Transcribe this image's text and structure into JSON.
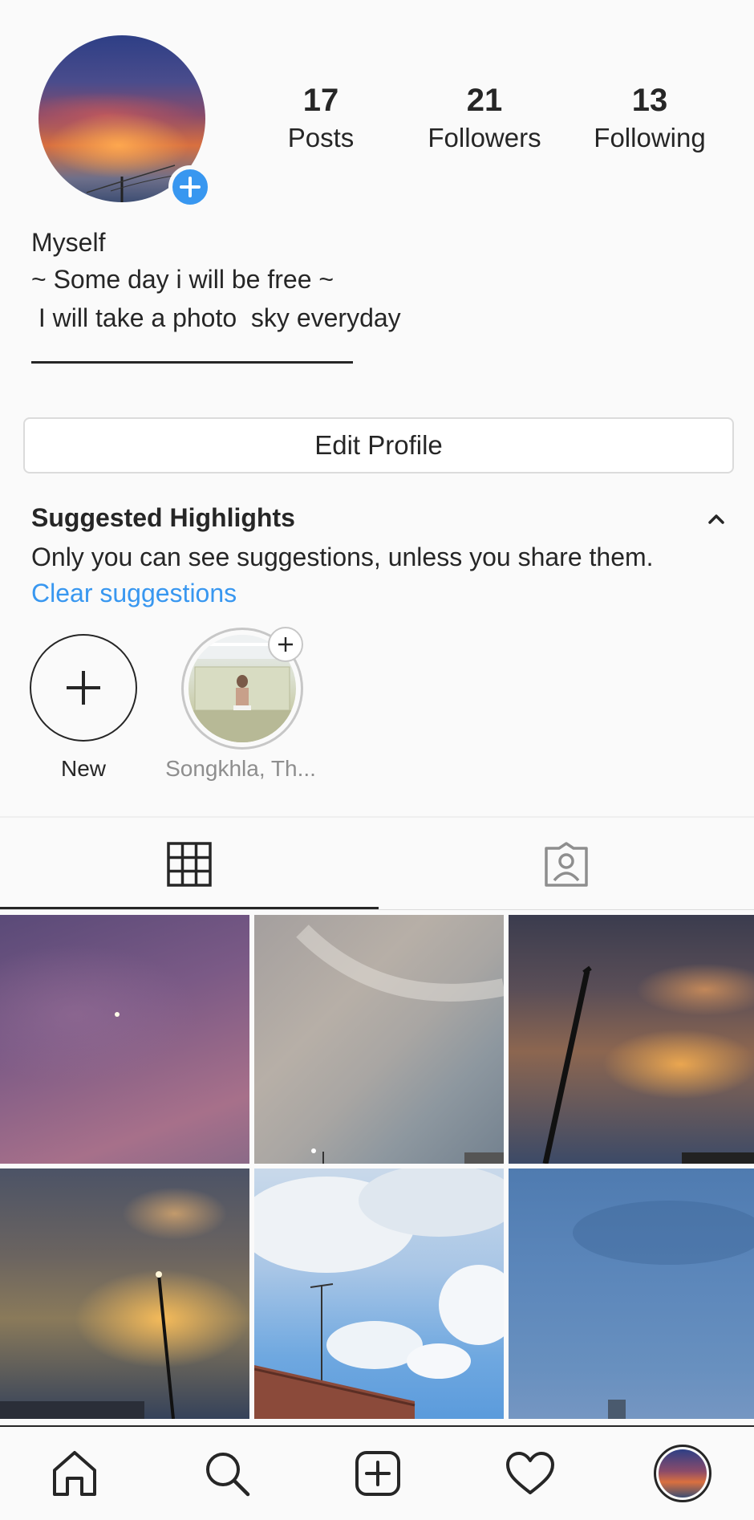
{
  "profile": {
    "avatar_icon": "profile-photo-sunset-sky",
    "add_story_icon": "plus-icon",
    "stats": [
      {
        "value": "17",
        "label": "Posts"
      },
      {
        "value": "21",
        "label": "Followers"
      },
      {
        "value": "13",
        "label": "Following"
      }
    ],
    "name": "Myself",
    "bio_lines": [
      "~ Some day i will be free ~",
      " I will take a photo  sky everyday"
    ]
  },
  "edit_profile_label": "Edit Profile",
  "suggested_highlights": {
    "title": "Suggested Highlights",
    "description": "Only you can see suggestions, unless you share them.",
    "clear_label": "Clear suggestions",
    "collapse_icon": "chevron-up-icon"
  },
  "highlights": [
    {
      "label": "New",
      "icon": "plus-icon"
    },
    {
      "label": "Songkhla, Th..."
    }
  ],
  "tabs": [
    {
      "name": "grid",
      "icon": "grid-icon",
      "active": true
    },
    {
      "name": "tagged",
      "icon": "tagged-person-icon",
      "active": false
    }
  ],
  "posts": [
    {
      "subject": "purple-evening-sky-with-star"
    },
    {
      "subject": "grey-cloudy-sky-with-streetlight"
    },
    {
      "subject": "sunset-clouds-with-pole"
    },
    {
      "subject": "golden-sunset-with-pole"
    },
    {
      "subject": "blue-sky-white-clouds-roof"
    },
    {
      "subject": "overcast-blue-sky-building"
    }
  ],
  "bottom_nav": [
    {
      "name": "home",
      "icon": "home-icon"
    },
    {
      "name": "search",
      "icon": "search-icon"
    },
    {
      "name": "new-post",
      "icon": "add-post-icon"
    },
    {
      "name": "activity",
      "icon": "heart-icon"
    },
    {
      "name": "profile",
      "icon": "profile-avatar-icon"
    }
  ],
  "colors": {
    "accent": "#3897f0",
    "text": "#262626",
    "muted": "#8e8e8e",
    "background": "#fafafa"
  }
}
